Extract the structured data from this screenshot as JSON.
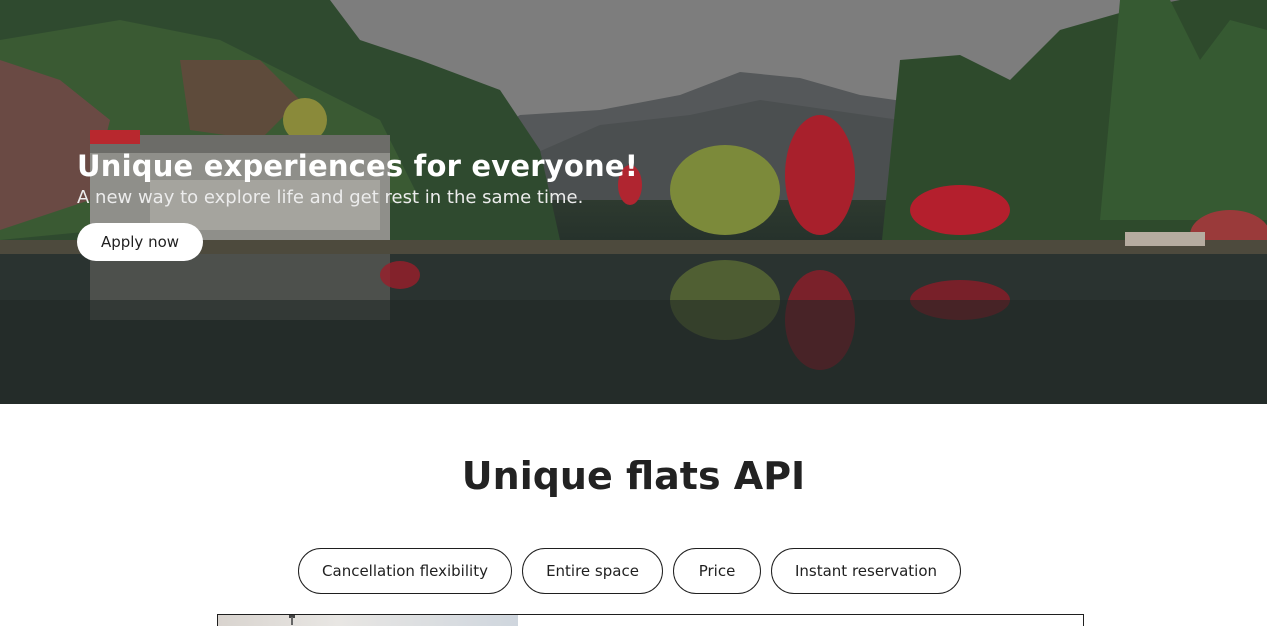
{
  "hero": {
    "title": "Unique experiences for everyone!",
    "subtitle": "A new way to explore life and get rest in the same time.",
    "cta_label": "Apply now"
  },
  "section": {
    "title": "Unique flats API"
  },
  "filters": [
    {
      "label": "Cancellation flexibility"
    },
    {
      "label": "Entire space"
    },
    {
      "label": "Price"
    },
    {
      "label": "Instant reservation"
    }
  ]
}
